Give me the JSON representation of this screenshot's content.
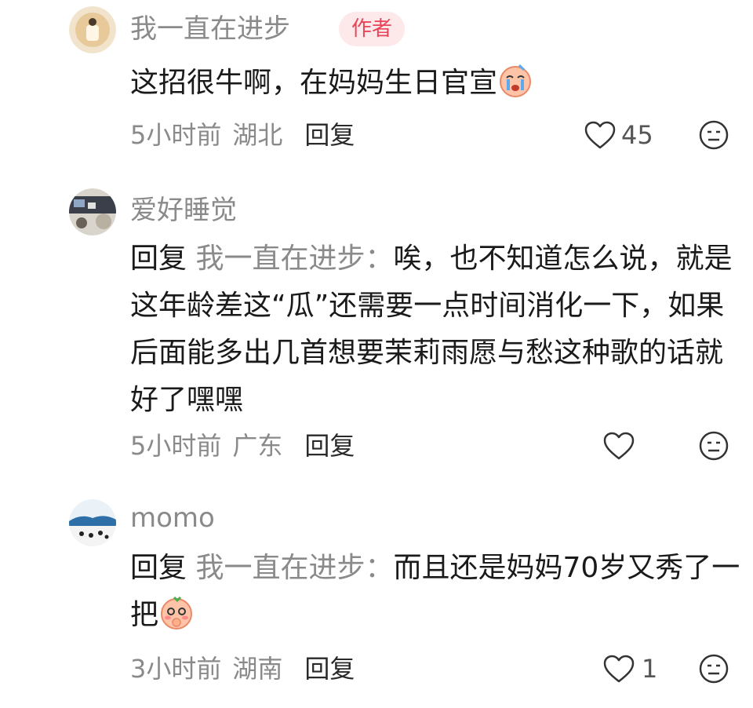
{
  "comments": [
    {
      "username": "我一直在进步",
      "badge": "作者",
      "text": "这招很牛啊，在妈妈生日官宣",
      "emoji": "crying-face-emoji",
      "time": "5小时前",
      "location": "湖北",
      "reply_label": "回复",
      "likes": "45"
    },
    {
      "username": "爱好睡觉",
      "reply_prefix": "回复",
      "reply_target": "我一直在进步：",
      "text": "唉，也不知道怎么说，就是这年龄差这“瓜”还需要一点时间消化一下，如果后面能多出几首想要茉莉雨愿与愁这种歌的话就好了嘿嘿",
      "time": "5小时前",
      "location": "广东",
      "reply_label": "回复",
      "likes": ""
    },
    {
      "username": "momo",
      "reply_prefix": "回复",
      "reply_target": "我一直在进步：",
      "text": "而且还是妈妈70岁又秀了一把",
      "emoji": "shy-face-emoji",
      "time": "3小时前",
      "location": "湖南",
      "reply_label": "回复",
      "likes": "1"
    }
  ],
  "colors": {
    "muted": "#8a8a8a",
    "badge_bg": "#fde8ea",
    "badge_text": "#e8445a"
  }
}
